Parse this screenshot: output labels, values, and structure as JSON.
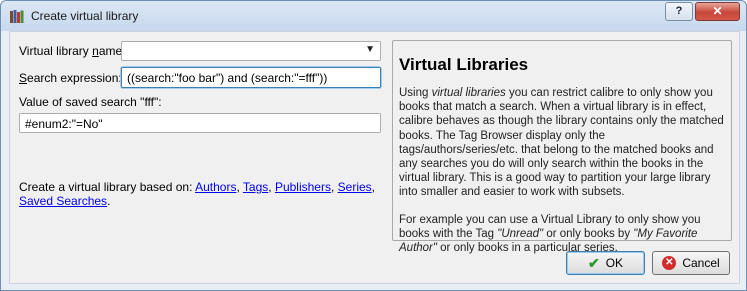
{
  "window": {
    "title": "Create virtual library",
    "help_glyph": "?",
    "close_glyph": "✕"
  },
  "form": {
    "name_label_prefix": "Virtual library ",
    "name_label_mnemonic": "n",
    "name_label_suffix": "ame:",
    "name_value": "",
    "search_label_mnemonic": "S",
    "search_label_suffix": "earch expression:",
    "search_value": "((search:\"foo bar\") and (search:\"=fff\"))",
    "saved_search_label": "Value of saved search \"fff\":",
    "saved_search_value": "#enum2:\"=No\""
  },
  "create_based_on": {
    "prefix": "Create a virtual library based on: ",
    "links": [
      "Authors",
      "Tags",
      "Publishers",
      "Series",
      "Saved Searches"
    ],
    "separator": ", ",
    "suffix": "."
  },
  "help": {
    "heading": "Virtual Libraries",
    "p1_a": "Using ",
    "p1_em": "virtual libraries",
    "p1_b": " you can restrict calibre to only show you books that match a search. When a virtual library is in effect, calibre behaves as though the library contains only the matched books. The Tag Browser display only the tags/authors/series/etc. that belong to the matched books and any searches you do will only search within the books in the virtual library. This is a good way to partition your large library into smaller and easier to work with subsets.",
    "p2_a": "For example you can use a Virtual Library to only show you books with the Tag ",
    "p2_em1": "\"Unread\"",
    "p2_b": " or only books by ",
    "p2_em2": "\"My Favorite Author\"",
    "p2_c": " or only books in a particular series."
  },
  "buttons": {
    "ok": "OK",
    "cancel": "Cancel"
  },
  "icons": {
    "app": "calibre-books-icon",
    "ok": "checkmark-icon",
    "cancel": "cancel-circle-icon"
  }
}
